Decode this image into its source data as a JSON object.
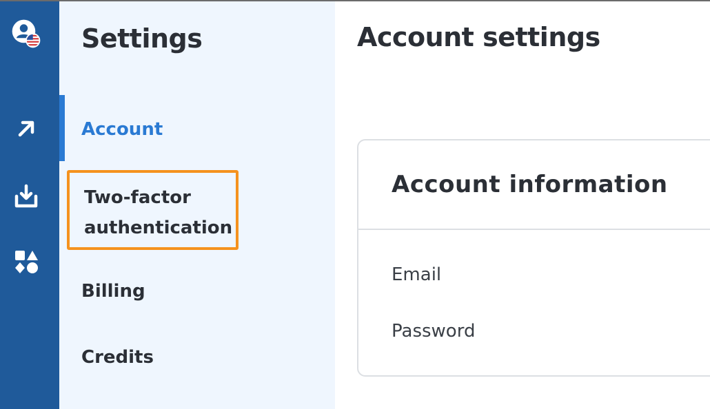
{
  "rail": {
    "items": [
      {
        "icon": "user-flag-icon"
      },
      {
        "icon": "arrow-up-right-icon"
      },
      {
        "icon": "download-icon"
      },
      {
        "icon": "shapes-icon"
      }
    ]
  },
  "sidebar": {
    "title": "Settings",
    "items": [
      {
        "label": "Account",
        "active": true
      },
      {
        "label": "Two-factor authentication",
        "highlighted": true
      },
      {
        "label": "Billing"
      },
      {
        "label": "Credits"
      }
    ]
  },
  "main": {
    "title": "Account settings",
    "card": {
      "title": "Account information",
      "fields": [
        {
          "label": "Email"
        },
        {
          "label": "Password"
        }
      ]
    }
  },
  "colors": {
    "rail_bg": "#1f5a9a",
    "sidebar_bg": "#eff6fe",
    "accent": "#2a7ad3",
    "highlight": "#f5921e"
  }
}
